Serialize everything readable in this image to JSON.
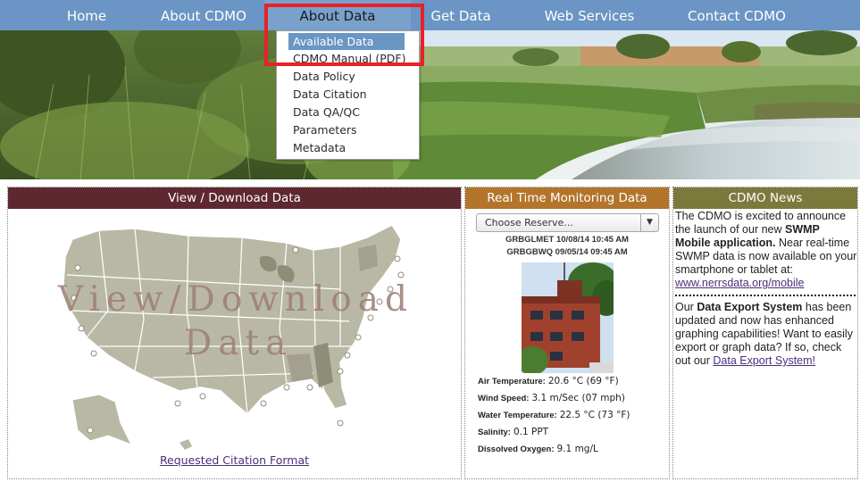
{
  "nav": {
    "items": [
      "Home",
      "About CDMO",
      "About Data",
      "Get Data",
      "Web Services",
      "Contact CDMO"
    ],
    "active": "About Data"
  },
  "dropdown": {
    "items": [
      "Available Data",
      "CDMO Manual (PDF)",
      "Data Policy",
      "Data Citation",
      "Data QA/QC",
      "Parameters",
      "Metadata"
    ],
    "selected": "Available Data"
  },
  "download_panel": {
    "title": "View / Download Data",
    "map_text_line1": "View/Download",
    "map_text_line2": "Data",
    "citation_link": "Requested Citation Format"
  },
  "realtime_panel": {
    "title": "Real Time Monitoring Data",
    "select_placeholder": "Choose Reserve...",
    "stations": [
      "GRBGLMET 10/08/14 10:45 AM",
      "GRBGBWQ 09/05/14 09:45 AM"
    ],
    "readings": [
      {
        "label": "Air Temperature:",
        "value": "20.6 °C (69 °F)"
      },
      {
        "label": "Wind Speed:",
        "value": "3.1 m/Sec (07 mph)"
      },
      {
        "label": "Water Temperature:",
        "value": "22.5 °C (73 °F)"
      },
      {
        "label": "Salinity:",
        "value": "0.1 PPT"
      },
      {
        "label": "Dissolved Oxygen:",
        "value": "9.1 mg/L"
      }
    ]
  },
  "news_panel": {
    "title": "CDMO News",
    "p1_a": "The CDMO is excited to announce the launch of our new ",
    "p1_bold": "SWMP Mobile application.",
    "p1_b": " Near real-time SWMP data is now available on your smartphone or tablet at:",
    "p1_link": "www.nerrsdata.org/mobile",
    "p2_a": "Our ",
    "p2_bold": "Data Export System",
    "p2_b": " has been updated and now has enhanced graphing capabilities! Want to easily export or graph data? If so, check out our ",
    "p2_link": "Data Export System!"
  },
  "colors": {
    "nav": "#6a95c4",
    "download_header": "#5e2830",
    "realtime_header": "#b3752b",
    "news_header": "#7b7a3c",
    "highlight": "#e8202a",
    "map_fill": "#b9b8a5"
  }
}
